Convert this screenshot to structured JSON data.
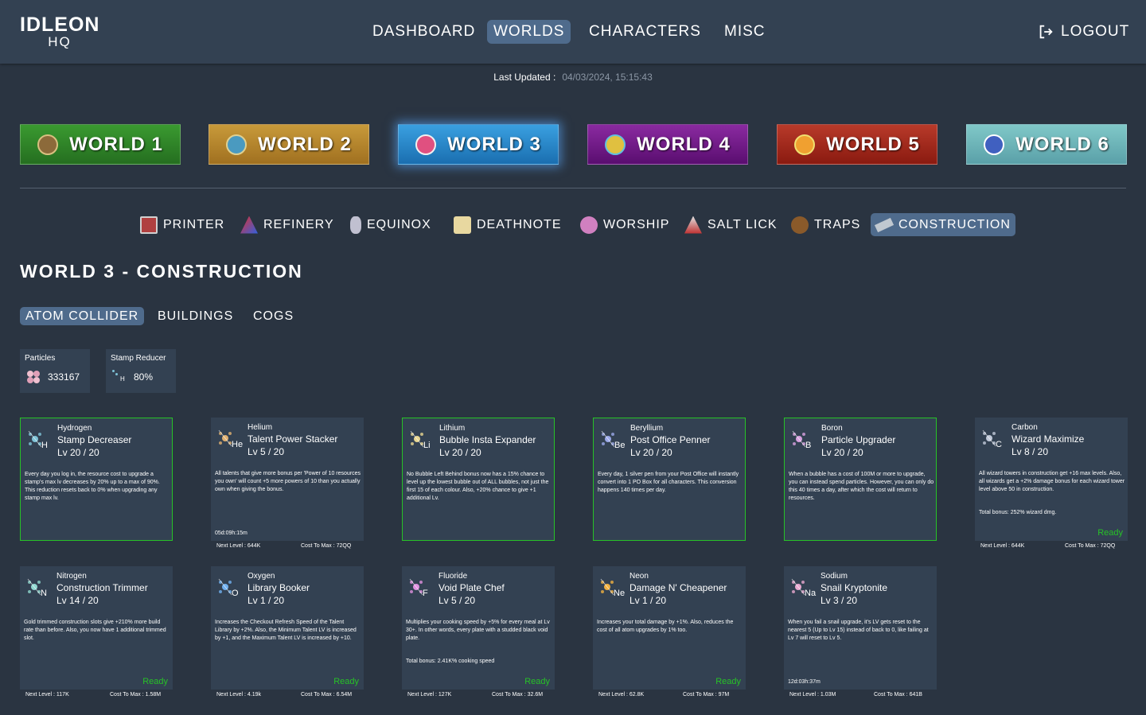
{
  "logo": {
    "main": "IDLEON",
    "sub": "HQ"
  },
  "nav": {
    "dashboard": "DASHBOARD",
    "worlds": "WORLDS",
    "characters": "CHARACTERS",
    "misc": "MISC",
    "logout": "LOGOUT"
  },
  "updated": {
    "label": "Last Updated :",
    "value": "04/03/2024, 15:15:43"
  },
  "worlds": [
    {
      "label": "WORLD 1",
      "color": "#2f8a2a"
    },
    {
      "label": "WORLD 2",
      "color": "#b98a2c"
    },
    {
      "label": "WORLD 3",
      "color": "#2a8fd0"
    },
    {
      "label": "WORLD 4",
      "color": "#7a1a8e"
    },
    {
      "label": "WORLD 5",
      "color": "#a52a1c"
    },
    {
      "label": "WORLD 6",
      "color": "#6fb7b8"
    }
  ],
  "subnav": [
    {
      "label": "PRINTER",
      "icon": "printer-icon"
    },
    {
      "label": "REFINERY",
      "icon": "refinery-icon"
    },
    {
      "label": "EQUINOX",
      "icon": "equinox-icon"
    },
    {
      "label": "DEATHNOTE",
      "icon": "deathnote-icon"
    },
    {
      "label": "WORSHIP",
      "icon": "worship-icon"
    },
    {
      "label": "SALT LICK",
      "icon": "salt-lick-icon"
    },
    {
      "label": "TRAPS",
      "icon": "traps-icon"
    },
    {
      "label": "CONSTRUCTION",
      "icon": "construction-icon"
    }
  ],
  "page_title": "WORLD 3 - CONSTRUCTION",
  "tabs": [
    "ATOM COLLIDER",
    "BUILDINGS",
    "COGS"
  ],
  "stats": {
    "particles": {
      "label": "Particles",
      "value": "333167"
    },
    "stamp_reducer": {
      "label": "Stamp Reducer",
      "value": "80%",
      "symbol": "H"
    }
  },
  "atoms": [
    {
      "name": "Hydrogen",
      "symbol": "H",
      "upgrade": "Stamp Decreaser",
      "level": "Lv 20 / 20",
      "desc": "Every day you log in, the resource cost to upgrade a stamp's max lv decreases by 20% up to a max of 90%. This reduction resets back to 0% when upgrading any stamp max lv.",
      "color": "#7fc4d8"
    },
    {
      "name": "Helium",
      "symbol": "He",
      "upgrade": "Talent Power Stacker",
      "level": "Lv 5 / 20",
      "desc": "All talents that give more bonus per 'Power of 10 resources you own' will count +5 more powers of 10 than you actually own when giving the bonus.",
      "timer": "05d:09h:15m",
      "next": "Next Level : 644K",
      "cost": "Cost To Max : 72QQ",
      "color": "#e0b070"
    },
    {
      "name": "Lithium",
      "symbol": "Li",
      "upgrade": "Bubble Insta Expander",
      "level": "Lv 20 / 20",
      "desc": "No Bubble Left Behind bonus now has a 15% chance to level up the lowest bubble out of ALL bubbles, not just the first 15 of each colour. Also, +20% chance to give +1 additional Lv.",
      "color": "#e8d690"
    },
    {
      "name": "Beryllium",
      "symbol": "Be",
      "upgrade": "Post Office Penner",
      "level": "Lv 20 / 20",
      "desc": "Every day, 1 silver pen from your Post Office will instantly convert into 1 PO Box for all characters. This conversion happens 140 times per day.",
      "color": "#9aa8e8"
    },
    {
      "name": "Boron",
      "symbol": "B",
      "upgrade": "Particle Upgrader",
      "level": "Lv 20 / 20",
      "desc": "When a bubble has a cost of 100M or more to upgrade, you can instead spend particles. However, you can only do this 40 times a day, after which the cost will return to resources.",
      "color": "#d8a0e0"
    },
    {
      "name": "Carbon",
      "symbol": "C",
      "upgrade": "Wizard Maximize",
      "level": "Lv 8 / 20",
      "desc": "All wizard towers in construction get +16 max levels. Also, all wizards get a +2% damage bonus for each wizard tower level above 50 in construction.",
      "bonus": "Total bonus: 252% wizard dmg.",
      "ready": "Ready",
      "next": "Next Level : 644K",
      "cost": "Cost To Max : 72QQ",
      "color": "#c0c8d8"
    },
    {
      "name": "Nitrogen",
      "symbol": "N",
      "upgrade": "Construction Trimmer",
      "level": "Lv 14 / 20",
      "desc": "Gold trimmed construction slots give +210% more build rate than before. Also, you now have 1 additional trimmed slot.",
      "ready": "Ready",
      "next": "Next Level : 117K",
      "cost": "Cost To Max : 1.58M",
      "color": "#90d8d0"
    },
    {
      "name": "Oxygen",
      "symbol": "O",
      "upgrade": "Library Booker",
      "level": "Lv 1 / 20",
      "desc": "Increases the Checkout Refresh Speed of the Talent Library by +2%. Also, the Minimum Talent LV is increased by +1, and the Maximum Talent LV is increased by +10.",
      "ready": "Ready",
      "next": "Next Level : 4.19k",
      "cost": "Cost To Max : 6.54M",
      "color": "#70b0f0"
    },
    {
      "name": "Fluoride",
      "symbol": "F",
      "upgrade": "Void Plate Chef",
      "level": "Lv 5 / 20",
      "desc": "Multiplies your cooking speed by +5% for every meal at Lv 30+. In other words, every plate with a studded black void plate.",
      "bonus": "Total bonus: 2.41K% cooking speed",
      "ready": "Ready",
      "next": "Next Level : 127K",
      "cost": "Cost To Max : 32.6M",
      "color": "#e090e0"
    },
    {
      "name": "Neon",
      "symbol": "Ne",
      "upgrade": "Damage N' Cheapener",
      "level": "Lv 1 / 20",
      "desc": "Increases your total damage by +1%. Also, reduces the cost of all atom upgrades by 1% too.",
      "ready": "Ready",
      "next": "Next Level : 62.8K",
      "cost": "Cost To Max : 97M",
      "color": "#f0b040"
    },
    {
      "name": "Sodium",
      "symbol": "Na",
      "upgrade": "Snail Kryptonite",
      "level": "Lv 3 / 20",
      "desc": "When you fail a snail upgrade, it's LV gets reset to the nearest 5 (Up to Lv 15) instead of back to 0, like failing at Lv 7 will reset to Lv 5.",
      "timer": "12d:03h:37m",
      "next": "Next Level : 1.03M",
      "cost": "Cost To Max : 641B",
      "color": "#e8a8d0"
    }
  ]
}
